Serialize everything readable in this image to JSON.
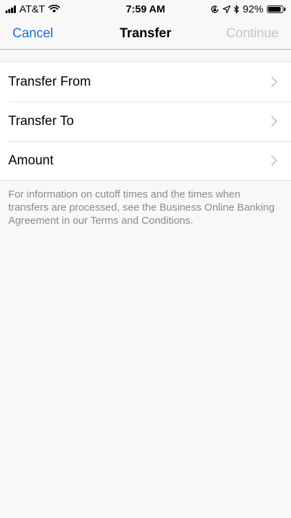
{
  "status_bar": {
    "carrier": "AT&T",
    "time": "7:59 AM",
    "battery_percent": "92%",
    "battery_level": 0.92,
    "icons": [
      "signal-icon",
      "wifi-icon",
      "rotation-lock-icon",
      "location-icon",
      "bluetooth-icon",
      "battery-icon"
    ]
  },
  "nav": {
    "cancel_label": "Cancel",
    "title": "Transfer",
    "continue_label": "Continue"
  },
  "rows": [
    {
      "label": "Transfer From"
    },
    {
      "label": "Transfer To"
    },
    {
      "label": "Amount"
    }
  ],
  "footnote": "For information on cutoff times and the times when transfers are processed, see the Business Online Banking Agreement in our Terms and Conditions.",
  "colors": {
    "accent": "#1a6fd8",
    "disabled": "#c4c4c6",
    "background": "#f8f8f8",
    "footnote": "#8a8a8f"
  }
}
